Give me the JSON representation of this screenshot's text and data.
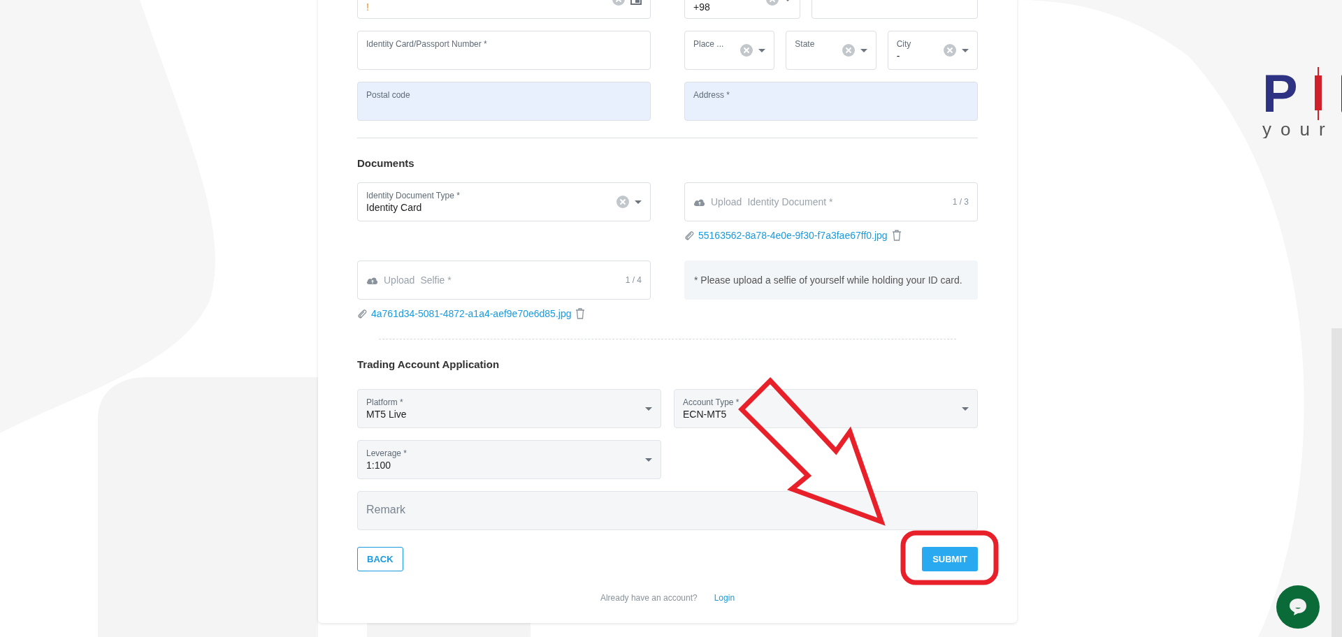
{
  "sections": [
    {
      "kind": "plain",
      "cells": [
        {
          "fields": [
            {
              "kind": "date",
              "value": "!",
              "invalid": true,
              "clearable": true
            }
          ]
        },
        {
          "fields": [
            {
              "kind": "select",
              "value": "+98",
              "clearable": true,
              "compact": true
            },
            {
              "kind": "input"
            }
          ]
        },
        {
          "fields": [
            {
              "kind": "input",
              "label": "Identity Card/Passport Number *"
            }
          ]
        },
        {
          "fields": [
            {
              "kind": "select",
              "label": "Place ...",
              "clearable": true
            },
            {
              "kind": "select",
              "label": "State",
              "clearable": true
            },
            {
              "kind": "select",
              "label": "City",
              "value": "-",
              "clearable": true
            }
          ]
        },
        {
          "fields": [
            {
              "kind": "input",
              "label": "Postal code",
              "autofill": true
            }
          ]
        },
        {
          "fields": [
            {
              "kind": "input",
              "label": "Address *",
              "autofill": true
            }
          ]
        }
      ]
    },
    {
      "kind": "documents",
      "title": "Documents",
      "cells": [
        {
          "fields": [
            {
              "kind": "select",
              "label": "Identity Document Type *",
              "value": "Identity Card",
              "clearable": true
            }
          ]
        },
        {
          "fields": [
            {
              "kind": "upload",
              "prompt": "Upload",
              "label": "Identity Document *",
              "count": "1 / 3"
            }
          ],
          "files": [
            "55163562-8a78-4e0e-9f30-f7a3fae67ff0.jpg"
          ]
        },
        {
          "fields": [
            {
              "kind": "upload",
              "prompt": "Upload",
              "label": "Selfie *",
              "count": "1 / 4"
            }
          ],
          "files": [
            "4a761d34-5081-4872-a1a4-aef9e70e6d85.jpg"
          ]
        },
        {
          "fields": [
            {
              "kind": "note",
              "text": "* Please upload a selfie of yourself while holding your ID card."
            }
          ]
        }
      ]
    },
    {
      "kind": "trading",
      "title": "Trading Account Application",
      "cells": [
        {
          "fields": [
            {
              "kind": "select",
              "label": "Platform *",
              "value": "MT5 Live",
              "filled": true
            }
          ]
        },
        {
          "fields": [
            {
              "kind": "select",
              "label": "Account Type *",
              "value": "ECN-MT5",
              "filled": true
            }
          ]
        },
        {
          "fields": [
            {
              "kind": "select",
              "label": "Leverage *",
              "value": "1:100",
              "filled": true
            }
          ]
        },
        {
          "fields": [
            {
              "kind": "textarea",
              "placeholder": "Remark",
              "filled": true
            }
          ],
          "wide": true
        }
      ]
    }
  ],
  "actions": {
    "back": "BACK",
    "submit": "SUBMIT"
  },
  "footer": {
    "prompt": "Already have an account?",
    "link": "Login"
  },
  "logo": {
    "mark": "P",
    "tagline": "your"
  },
  "callout": {
    "arrow": true,
    "frame": true
  }
}
